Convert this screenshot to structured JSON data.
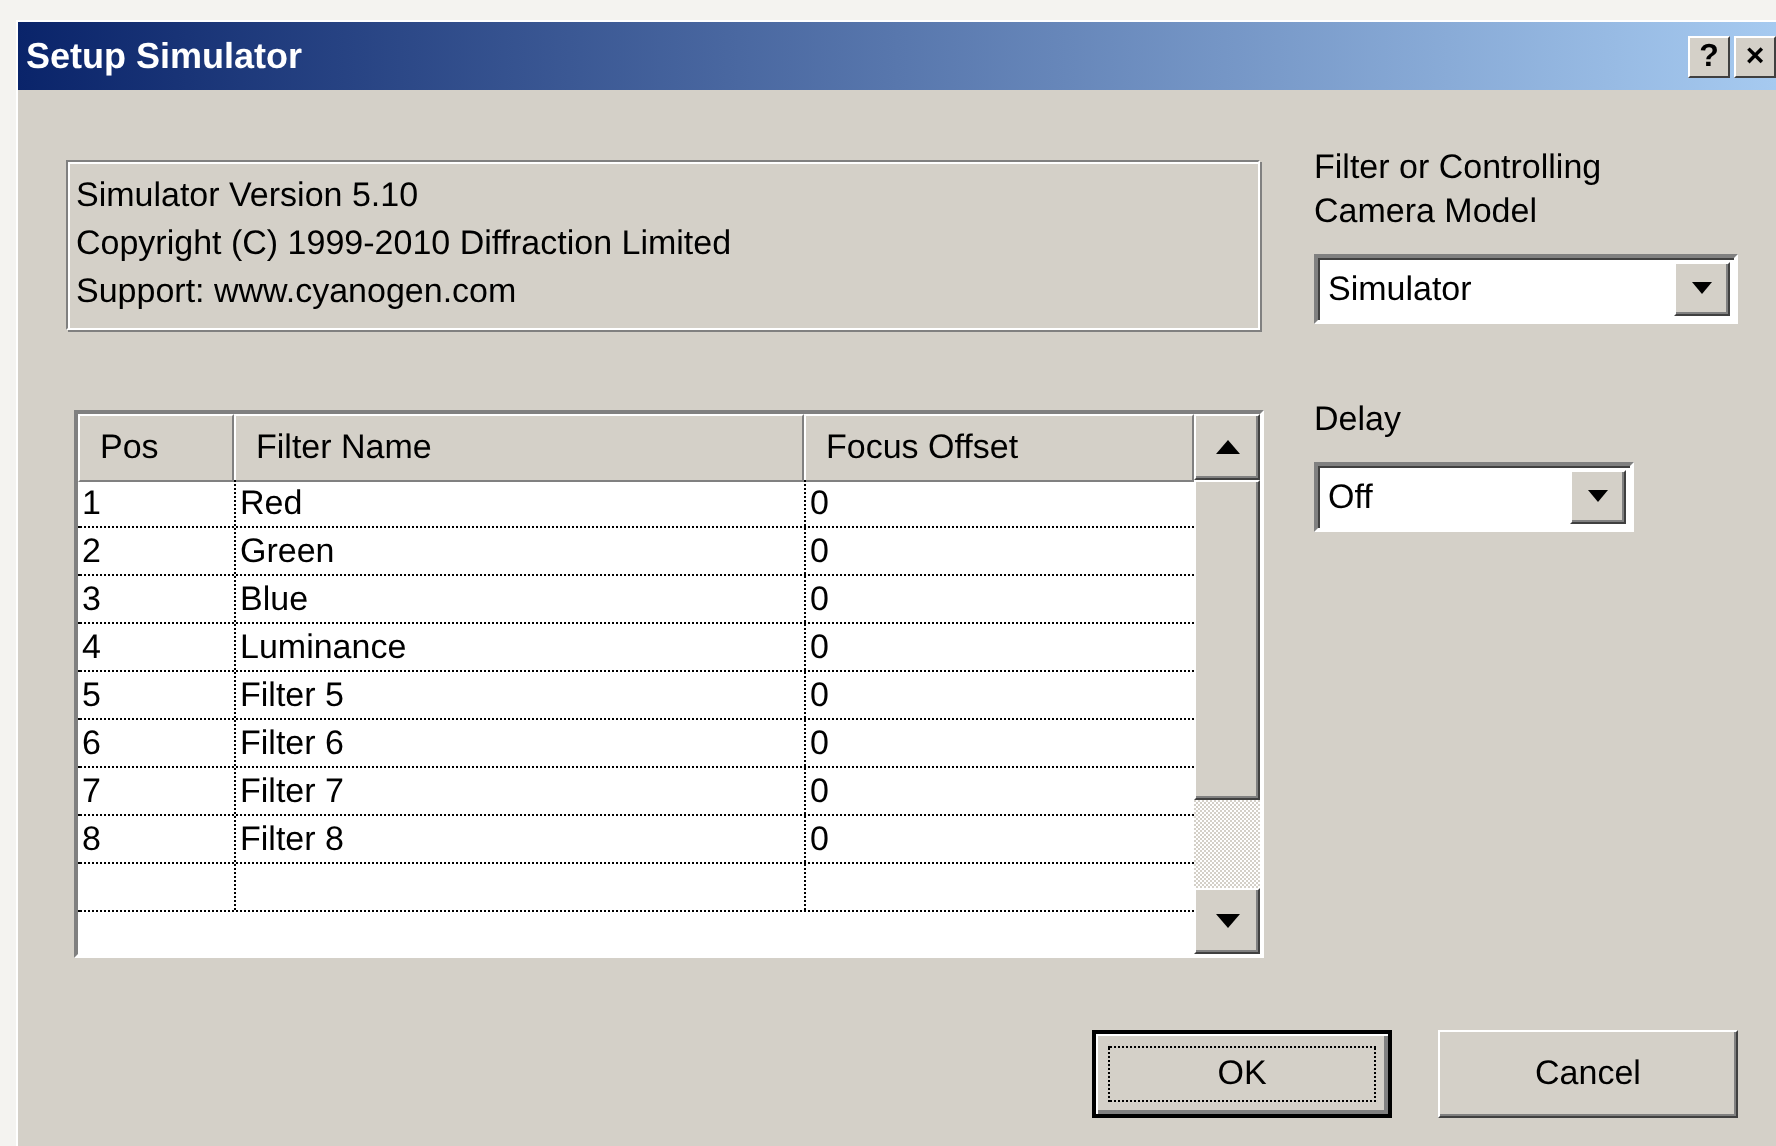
{
  "window": {
    "title": "Setup Simulator",
    "title_buttons": [
      "?",
      "×"
    ]
  },
  "info_lines": [
    "Simulator Version 5.10",
    "Copyright (C) 1999-2010 Diffraction Limited",
    "Support: www.cyanogen.com"
  ],
  "camera_model": {
    "label": "Filter or Controlling Camera Model",
    "value": "Simulator"
  },
  "delay": {
    "label": "Delay",
    "value": "Off"
  },
  "table": {
    "columns": [
      "Pos",
      "Filter Name",
      "Focus Offset"
    ],
    "rows": [
      [
        "1",
        "Red",
        "0"
      ],
      [
        "2",
        "Green",
        "0"
      ],
      [
        "3",
        "Blue",
        "0"
      ],
      [
        "4",
        "Luminance",
        "0"
      ],
      [
        "5",
        "Filter 5",
        "0"
      ],
      [
        "6",
        "Filter 6",
        "0"
      ],
      [
        "7",
        "Filter 7",
        "0"
      ],
      [
        "8",
        "Filter 8",
        "0"
      ]
    ]
  },
  "buttons": [
    {
      "label": "OK",
      "default": true
    },
    {
      "label": "Cancel",
      "default": false
    }
  ]
}
